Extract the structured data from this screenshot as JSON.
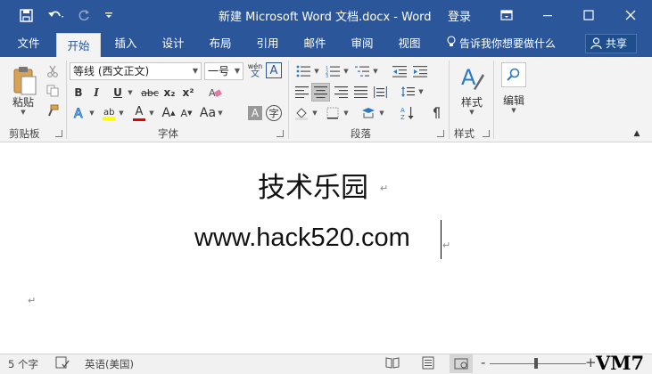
{
  "titlebar": {
    "title": "新建 Microsoft Word 文档.docx  -  Word",
    "signin": "登录",
    "bg_color": "#2b579a"
  },
  "tabs": [
    {
      "label": "文件",
      "active": false
    },
    {
      "label": "开始",
      "active": true
    },
    {
      "label": "插入",
      "active": false
    },
    {
      "label": "设计",
      "active": false
    },
    {
      "label": "布局",
      "active": false
    },
    {
      "label": "引用",
      "active": false
    },
    {
      "label": "邮件",
      "active": false
    },
    {
      "label": "审阅",
      "active": false
    },
    {
      "label": "视图",
      "active": false
    }
  ],
  "tellme": "告诉我你想要做什么",
  "share": "共享",
  "ribbon": {
    "clipboard": {
      "label": "剪贴板",
      "paste_label": "粘贴"
    },
    "font": {
      "label": "字体",
      "font_name": "等线 (西文正文)",
      "font_size": "一号",
      "bold": "B",
      "italic": "I",
      "underline": "U",
      "strike": "abc",
      "subscript": "x₂",
      "superscript": "x²",
      "font_color": "A",
      "grow": "A",
      "shrink": "A",
      "phonetic_top": "wén",
      "phonetic_bottom": "文",
      "char_border": "A",
      "char_shading": "A",
      "enclose": "字"
    },
    "paragraph": {
      "label": "段落"
    },
    "styles": {
      "label": "样式",
      "button_label": "样式"
    },
    "editing": {
      "button_label": "编辑"
    }
  },
  "document": {
    "heading": "技术乐园",
    "url": "www.hack520.com"
  },
  "statusbar": {
    "word_count": "5 个字",
    "language": "英语(美国)",
    "zoom_plus": "+",
    "zoom_minus": "-"
  },
  "watermark": "VM7"
}
